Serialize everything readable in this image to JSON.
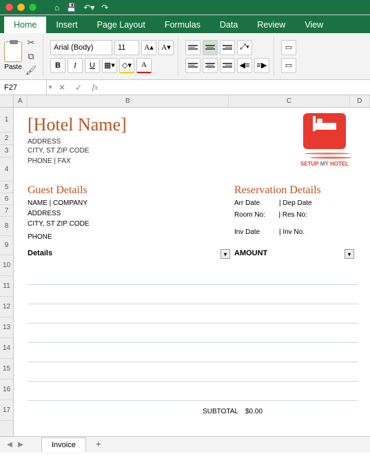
{
  "ribbon": {
    "tabs": [
      "Home",
      "Insert",
      "Page Layout",
      "Formulas",
      "Data",
      "Review",
      "View"
    ],
    "paste_label": "Paste",
    "font_name": "Arial (Body)",
    "font_size": "11",
    "bold": "B",
    "italic": "I",
    "underline": "U",
    "inc_font": "A▴",
    "dec_font": "A▾",
    "font_color": "A",
    "fill_color": "◆"
  },
  "formula_bar": {
    "cell_ref": "F27",
    "formula": ""
  },
  "columns": [
    "A",
    "B",
    "C",
    "D"
  ],
  "rows": [
    "1",
    "2",
    "3",
    "4",
    "5",
    "6",
    "7",
    "8",
    "9",
    "10",
    "11",
    "12",
    "13",
    "14",
    "15",
    "16",
    "17"
  ],
  "invoice": {
    "hotel_name": "[Hotel Name]",
    "address": "ADDRESS",
    "city_state": "CITY, ST ZIP CODE",
    "phone_fax": "PHONE | FAX",
    "logo_text_1": "SETUP",
    "logo_text_2": " MY ",
    "logo_text_3": "HOTEL",
    "guest_title": "Guest Details",
    "guest_name": "NAME | COMPANY",
    "guest_address": "ADDRESS",
    "guest_city": "CITY, ST ZIP CODE",
    "guest_phone": "PHONE",
    "res_title": "Reservation Details",
    "arr_date": "Arr Date",
    "dep_date": "| Dep Date",
    "room_no": "Room No:",
    "res_no": "| Res No:",
    "inv_date": "Inv Date",
    "inv_no": "| Inv No.",
    "details_hdr": "Details",
    "amount_hdr": "AMOUNT",
    "subtotal_label": "SUBTOTAL",
    "subtotal_value": "$0.00"
  },
  "sheet_tabs": {
    "active": "Invoice"
  }
}
